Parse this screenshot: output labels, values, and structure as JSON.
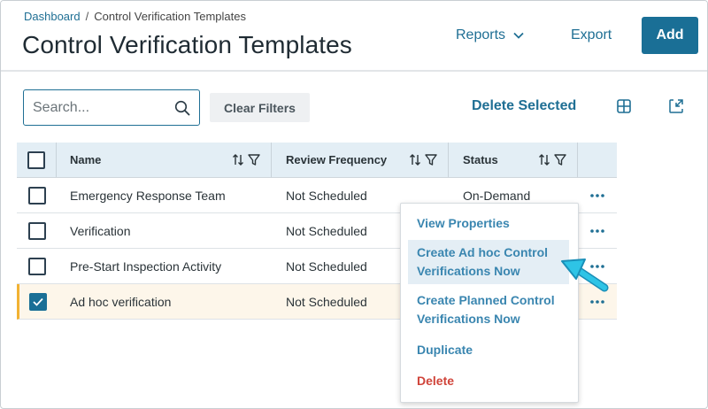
{
  "breadcrumb": {
    "home": "Dashboard",
    "separator": "/",
    "current": "Control Verification Templates"
  },
  "header": {
    "title": "Control Verification Templates",
    "reports_label": "Reports",
    "export_label": "Export",
    "add_label": "Add"
  },
  "toolbar": {
    "search_placeholder": "Search...",
    "search_value": "",
    "clear_filters_label": "Clear Filters",
    "delete_selected_label": "Delete Selected"
  },
  "table": {
    "columns": [
      "Name",
      "Review Frequency",
      "Status"
    ],
    "rows": [
      {
        "name": "Emergency Response Team",
        "frequency": "Not Scheduled",
        "status": "On-Demand",
        "checked": false
      },
      {
        "name": "Verification",
        "frequency": "Not Scheduled",
        "status": "",
        "checked": false
      },
      {
        "name": "Pre-Start Inspection Activity",
        "frequency": "Not Scheduled",
        "status": "",
        "checked": false
      },
      {
        "name": "Ad hoc verification",
        "frequency": "Not Scheduled",
        "status": "",
        "checked": true
      }
    ]
  },
  "context_menu": {
    "items": [
      {
        "label": "View Properties"
      },
      {
        "label": "Create Ad hoc Control Verifications Now",
        "line1": "Create Ad hoc Control",
        "line2": "Verifications Now"
      },
      {
        "label": "Create Planned Control Verifications Now",
        "line1": "Create Planned Control",
        "line2": "Verifications Now"
      },
      {
        "label": "Duplicate"
      },
      {
        "label": "Delete"
      }
    ]
  },
  "colors": {
    "accent": "#1a6f96",
    "link": "#1f6f94",
    "menu_text": "#3a86b0",
    "danger": "#d0443a",
    "selected_row_marker": "#f2b233",
    "pointer_arrow": "#1fb3d6"
  }
}
